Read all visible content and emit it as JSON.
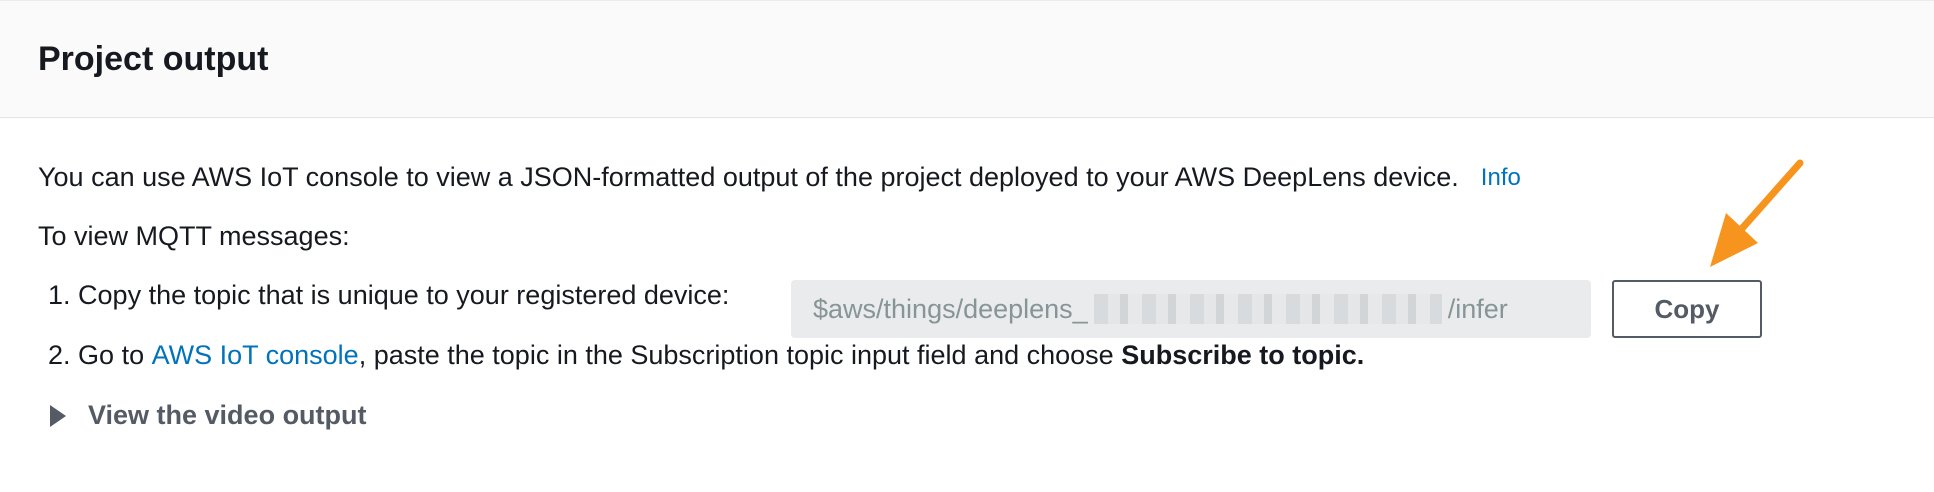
{
  "panel": {
    "title": "Project output"
  },
  "intro": {
    "text": "You can use AWS IoT console to view a JSON-formatted output of the project deployed to your AWS DeepLens device.",
    "info_link": "Info"
  },
  "mqtt": {
    "heading": "To view MQTT messages:",
    "step1": {
      "number": "1.",
      "text": "Copy the topic that is unique to your registered device:",
      "topic_prefix": "$aws/things/deeplens_",
      "topic_suffix": "/infer",
      "copy_label": "Copy"
    },
    "step2": {
      "number": "2.",
      "prefix": "Go to",
      "link": "AWS IoT console",
      "middle": ", paste the topic in the Subscription topic input field and choose",
      "strong": "Subscribe to topic."
    }
  },
  "expander": {
    "label": "View the video output",
    "expanded": false
  },
  "annotation": {
    "arrow_color": "#f7941d"
  }
}
